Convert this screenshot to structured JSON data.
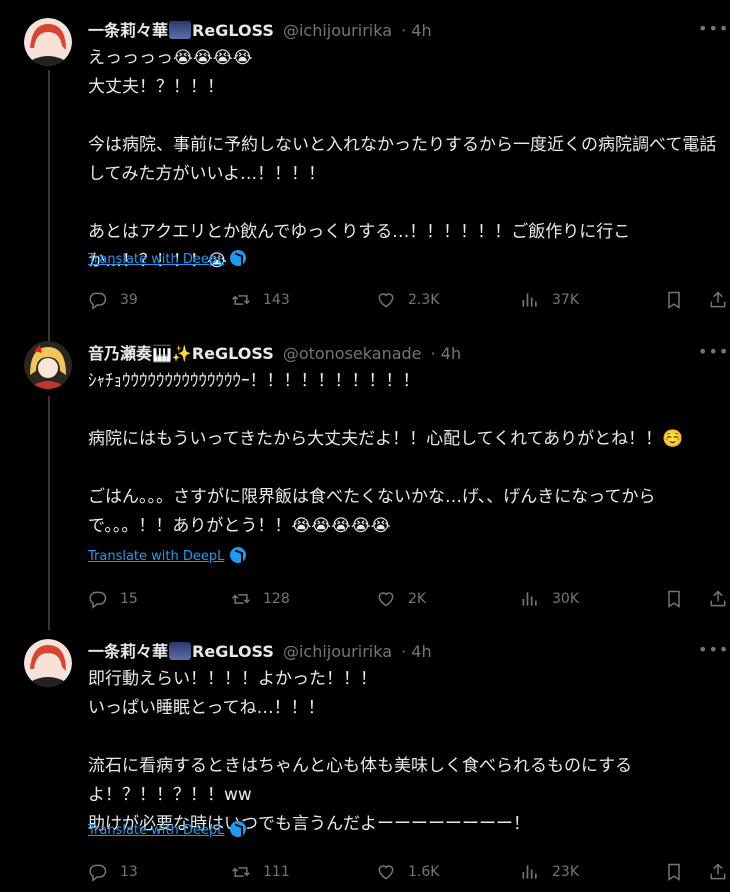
{
  "tweets": [
    {
      "display_name": "一条莉々華",
      "brand": "ReGLOSS",
      "handle": "@ichijouririka",
      "time": "4h",
      "text": "えっっっっ😭😭😭😭\n大丈夫！？！！！\n\n今は病院、事前に予約しないと入れなかったりするから一度近くの病院調べて電話してみた方がいいよ…！！！！\n\nあとはアクエリとか飲んでゆっくりする…！！！！！！ご飯作りに行こか…！？！！！😭",
      "translate_label": "Translate with DeepL",
      "replies": "39",
      "reposts": "143",
      "likes": "2.3K",
      "views": "37K"
    },
    {
      "display_name": "音乃瀬奏🎹✨",
      "brand": "ReGLOSS",
      "handle": "@otonosekanade",
      "time": "4h",
      "text": "ｼｬﾁｮｳｳｳｳｳｳｳｳｳｳｳｳｳｳｰ！！！！！！！！！！\n\n病院にはもういってきたから大丈夫だよ！！心配してくれてありがとね！！☺️\n\nごはん。。。さすがに限界飯は食べたくないかな…げ、、げんきになってからで。。。！！ありがとう！！😭😭😭😭😭",
      "translate_label": "Translate with DeepL",
      "replies": "15",
      "reposts": "128",
      "likes": "2K",
      "views": "30K"
    },
    {
      "display_name": "一条莉々華",
      "brand": "ReGLOSS",
      "handle": "@ichijouririka",
      "time": "4h",
      "text": "即行動えらい！！！！よかった！！！\nいっぱい睡眠とってね…！！！\n\n流石に看病するときはちゃんと心も体も美味しく食べられるものにするよ！？！！？！！ww\n助けが必要な時はいつでも言うんだよーーーーーーーー！",
      "translate_label": "Translate with DeepL",
      "replies": "13",
      "reposts": "111",
      "likes": "1.6K",
      "views": "23K"
    }
  ],
  "colors": {
    "background": "#000000",
    "text": "#e7e9ea",
    "muted": "#71767b",
    "link": "#1d9bf0",
    "thread_line": "#333639"
  }
}
